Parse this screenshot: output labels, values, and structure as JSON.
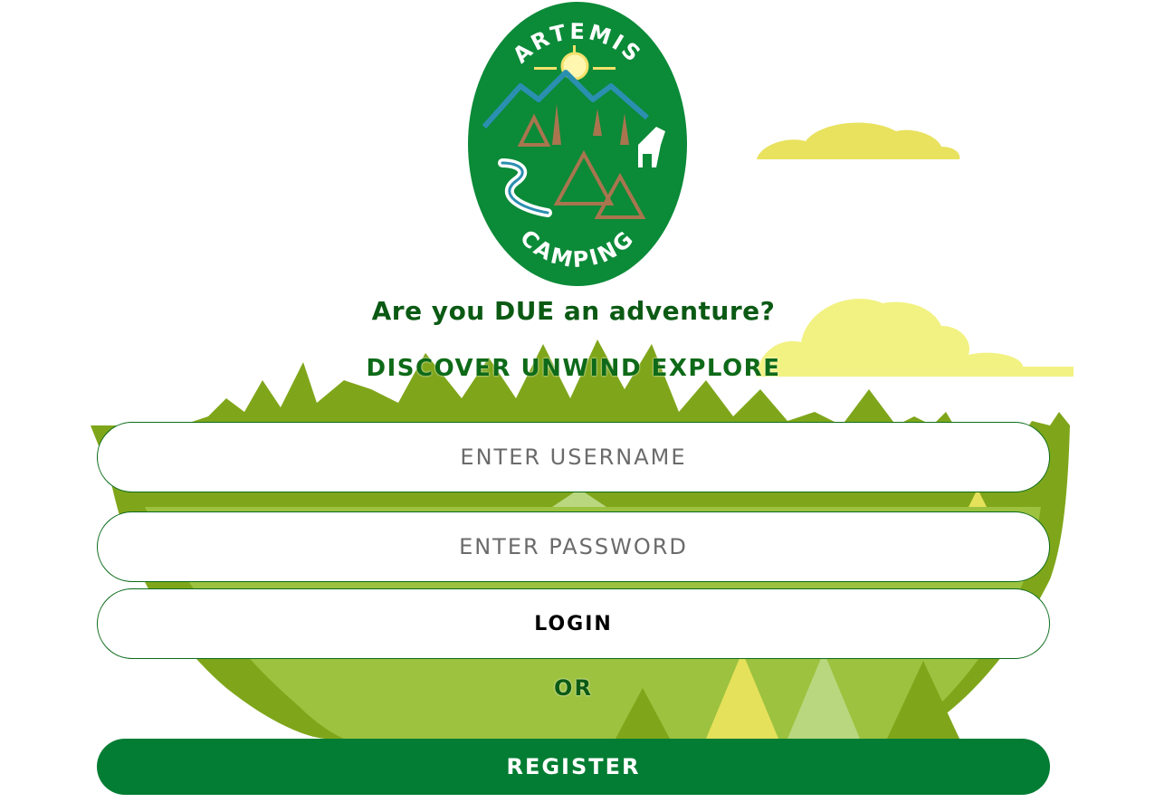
{
  "logo": {
    "top_text": "ARTEMIS",
    "bottom_text": "CAMPING",
    "color": "#0b8a38"
  },
  "tagline": "Are you DUE an adventure?",
  "motto": "DISCOVER UNWIND EXPLORE",
  "form": {
    "username_placeholder": "ENTER USERNAME",
    "password_placeholder": "ENTER PASSWORD",
    "login_label": "LOGIN",
    "or_label": "OR",
    "register_label": "REGISTER"
  },
  "colors": {
    "primary_green": "#027d33",
    "text_green": "#0b5a14",
    "cloud_yellow": "#f2f283",
    "forest_green": "#7fa61a"
  }
}
